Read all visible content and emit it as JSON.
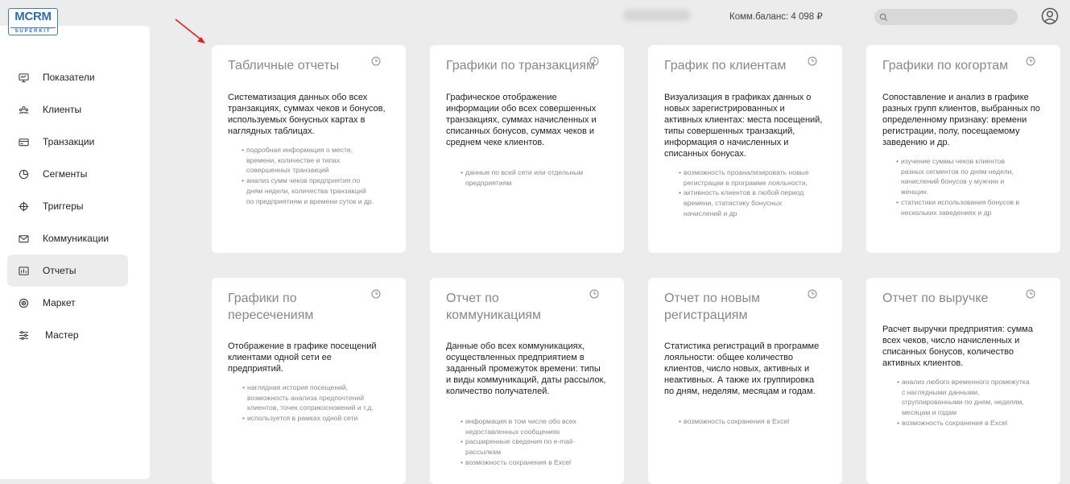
{
  "logo": {
    "main": "MCRM",
    "sub": "SUPERKIT"
  },
  "sidebar": {
    "items": [
      {
        "label": "Показатели",
        "icon": "monitor-icon"
      },
      {
        "label": "Клиенты",
        "icon": "users-icon"
      },
      {
        "label": "Транзакции",
        "icon": "card-icon"
      },
      {
        "label": "Сегменты",
        "icon": "pie-icon"
      },
      {
        "label": "Триггеры",
        "icon": "crosshair-icon"
      },
      {
        "label": "Коммуникации",
        "icon": "mail-icon"
      },
      {
        "label": "Отчеты",
        "icon": "report-icon",
        "active": true
      },
      {
        "label": "Маркет",
        "icon": "target-icon"
      },
      {
        "label": "Мастер",
        "icon": "sliders-icon"
      }
    ]
  },
  "header": {
    "balance": "Комм.баланс: 4 098 ₽",
    "search_placeholder": ""
  },
  "cards": [
    {
      "title": "Табличные отчеты",
      "description": "Систематизация данных обо всех транзакциях, суммах чеков и бонусов, используемых бонусных картах в наглядных таблицах.",
      "bullets": [
        "подробная информация о месте, времени, количестве и типах совершенных транзакций",
        "анализ сумм чеков предприятия по дням недели, количества транзакций по предприятиям и времени суток и др."
      ]
    },
    {
      "title": "Графики по транзакциям",
      "description": "Графическое отображение информации обо всех совершенных транзакциях, суммах начисленных и списанных бонусов, суммах чеков и среднем чеке клиентов.",
      "bullets": [
        "данные по всей сети или отдельным предприятиям"
      ]
    },
    {
      "title": "График по клиентам",
      "description": "Визуализация в графиках данных о новых зарегистрированных и активных клиентах: места посещений, типы совершенных транзакций, информация о начисленных и списанных бонусах.",
      "bullets": [
        "возможность проанализировать новые регистрации в программе лояльности,",
        "активность клиентов в любой период времени, статистику бонусных начислений и др"
      ]
    },
    {
      "title": "Графики по когортам",
      "description": "Сопоставление и анализ в графике разных групп клиентов, выбранных по определенному признаку: времени регистрации, полу, посещаемому заведению и др.",
      "bullets": [
        "изучение суммы чеков клиентов разных сегментов по дням недели, начислений бонусов у мужчин и женщин.",
        "статистики использования бонусов в нескольких заведениях и др"
      ]
    },
    {
      "title": "Графики по пересечениям",
      "description": "Отображение в графике посещений клиентами одной сети ее предприятий.",
      "bullets": [
        "наглядная история посещений, возможность анализа предпочтений клиентов, точек соприкосновений и т.д.",
        "используется в рамках одной сети"
      ]
    },
    {
      "title": "Отчет по коммуникациям",
      "description": "Данные обо всех коммуникациях, осуществленных предприятием в заданный промежуток времени: типы и виды коммуникаций, даты рассылок, количество получателей.",
      "bullets": [
        "информация в том числе обо всех недоставленных сообщениях",
        "расширенные сведения по e-mail-рассылкам",
        "возможность сохранения в Excel"
      ]
    },
    {
      "title": "Отчет по новым регистрациям",
      "description": "Статистика регистраций в программе лояльности: общее количество клиентов, число новых, активных и неактивных. А также их группировка по дням, неделям, месяцам и годам.",
      "bullets": [
        "возможность сохранения в Excel"
      ]
    },
    {
      "title": "Отчет по выручке",
      "description": "Расчет выручки предприятия: сумма всех чеков, число начисленных и списанных бонусов, количество активных клиентов.",
      "bullets": [
        "анализ любого временного промежутка с наглядными данными, сгруппированными по дням, неделям, месяцам и годам",
        "возможность сохранения в Excel"
      ]
    }
  ]
}
